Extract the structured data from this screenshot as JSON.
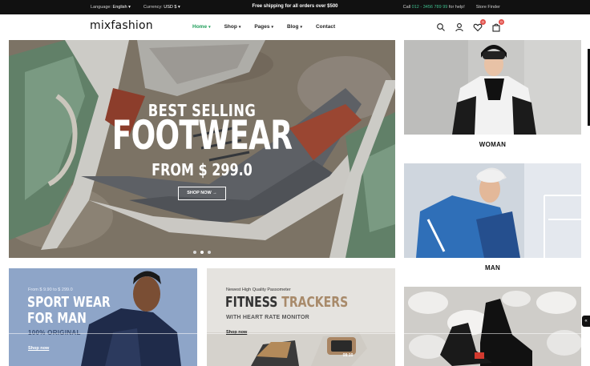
{
  "topbar": {
    "language_label": "Language:",
    "language_value": "English",
    "currency_label": "Currency:",
    "currency_value": "USD $",
    "promo": "Free shipping for all orders over $500",
    "call_prefix": "Call",
    "phone": "012 - 3456 789 99",
    "call_suffix": "for help!",
    "store_finder": "Store Finder"
  },
  "header": {
    "logo": "mixfashion",
    "nav": [
      {
        "label": "Home",
        "active": true
      },
      {
        "label": "Shop"
      },
      {
        "label": "Pages"
      },
      {
        "label": "Blog"
      },
      {
        "label": "Contact"
      }
    ],
    "wishlist_count": "0",
    "cart_count": "0"
  },
  "hero": {
    "line1": "BEST SELLING",
    "line2": "FOOTWEAR",
    "line3": "FROM $ 299.0",
    "button": "SHOP NOW"
  },
  "side_cards": [
    {
      "label": "WOMAN"
    },
    {
      "label": "MAN"
    }
  ],
  "banners": {
    "sport": {
      "price_range": "From $ 9.90 to $ 299.0",
      "title1": "SPORT WEAR",
      "title2": "FOR MAN",
      "subtitle": "100% ORIGINAL",
      "link": "Shop now"
    },
    "fitness": {
      "kicker": "Newest High Quality Passometer",
      "title1": "FITNESS",
      "title2": "TRACKERS",
      "subtitle": "WITH HEART RATE MONITOR",
      "link": "Shop now",
      "device_text": "08:10"
    }
  },
  "colors": {
    "accent": "#1f9e5a",
    "topbar_bg": "#111111",
    "badge": "#e2504a",
    "tracker_highlight": "#b38a5a"
  }
}
